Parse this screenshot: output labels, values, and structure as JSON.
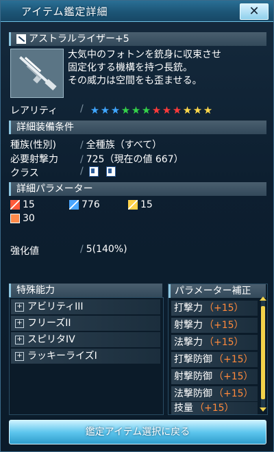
{
  "window": {
    "title": "アイテム鑑定詳細",
    "close_label": "✕"
  },
  "item": {
    "name": "アストラルライザー+5",
    "description": [
      "大気中のフォトンを銃身に収束させ",
      "固定化する機構を持つ長銃。",
      "その威力は空間をも歪ませる。"
    ]
  },
  "rarity": {
    "label": "レアリティ",
    "stars": [
      {
        "color": "#3fa6ff"
      },
      {
        "color": "#3fa6ff"
      },
      {
        "color": "#3fa6ff"
      },
      {
        "color": "#34d24a"
      },
      {
        "color": "#34d24a"
      },
      {
        "color": "#34d24a"
      },
      {
        "color": "#ff3b3b"
      },
      {
        "color": "#ff3b3b"
      },
      {
        "color": "#ff3b3b"
      },
      {
        "color": "#ffd84a"
      },
      {
        "color": "#ffd84a"
      },
      {
        "color": "#ffd84a"
      }
    ]
  },
  "requirements": {
    "header": "詳細装備条件",
    "rows": [
      {
        "label": "種族(性別)",
        "value": "全種族（すべて）"
      },
      {
        "label": "必要射撃力",
        "value": "725（現在の値 667）"
      },
      {
        "label": "クラス",
        "value": ""
      }
    ],
    "class_icons": [
      "ranger-class-icon",
      "gunner-class-icon"
    ]
  },
  "parameters": {
    "header": "詳細パラメーター",
    "stats": [
      {
        "icon": "melee-attack-icon",
        "value": "15"
      },
      {
        "icon": "ranged-attack-icon",
        "value": "776"
      },
      {
        "icon": "technique-attack-icon",
        "value": "15"
      },
      {
        "icon": "dexterity-icon",
        "value": "30"
      }
    ]
  },
  "grind": {
    "label": "強化値",
    "value": "5(140%)"
  },
  "special_abilities": {
    "header": "特殊能力",
    "items": [
      "アビリティIII",
      "フリーズII",
      "スピリタIV",
      "ラッキーライズI"
    ]
  },
  "param_correction": {
    "header": "パラメーター補正",
    "items": [
      {
        "name": "打撃力",
        "value": "（+15）"
      },
      {
        "name": "射撃力",
        "value": "（+15）"
      },
      {
        "name": "法撃力",
        "value": "（+15）"
      },
      {
        "name": "打撃防御",
        "value": "（+15）"
      },
      {
        "name": "射撃防御",
        "value": "（+15）"
      },
      {
        "name": "法撃防御",
        "value": "（+15）"
      },
      {
        "name": "技量",
        "value": "（+15）"
      }
    ]
  },
  "back_button": "鑑定アイテム選択に戻る"
}
